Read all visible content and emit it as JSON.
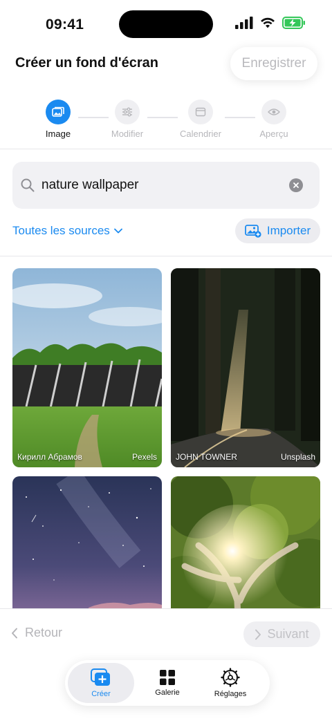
{
  "status_bar": {
    "time": "09:41"
  },
  "header": {
    "title": "Créer un fond d'écran",
    "save_label": "Enregistrer"
  },
  "stepper": {
    "steps": [
      {
        "label": "Image",
        "icon": "image-icon",
        "active": true
      },
      {
        "label": "Modifier",
        "icon": "sliders-icon",
        "active": false
      },
      {
        "label": "Calendrier",
        "icon": "calendar-icon",
        "active": false
      },
      {
        "label": "Aperçu",
        "icon": "eye-icon",
        "active": false
      }
    ]
  },
  "search": {
    "value": "nature wallpaper"
  },
  "sources": {
    "filter_label": "Toutes les sources",
    "import_label": "Importer"
  },
  "results": [
    {
      "author": "Кирилл Абрамов",
      "source": "Pexels",
      "scene": "field-with-fence"
    },
    {
      "author": "JOHN TOWNER",
      "source": "Unsplash",
      "scene": "forest-road"
    },
    {
      "author": "",
      "source": "",
      "scene": "starry-sky"
    },
    {
      "author": "",
      "source": "",
      "scene": "tree-canopy-sunburst"
    }
  ],
  "footer": {
    "back_label": "Retour",
    "next_label": "Suivant"
  },
  "tabbar": {
    "tabs": [
      {
        "label": "Créer",
        "icon": "create-plus-icon",
        "active": true
      },
      {
        "label": "Galerie",
        "icon": "grid-icon",
        "active": false
      },
      {
        "label": "Réglages",
        "icon": "settings-gear-icon",
        "active": false
      }
    ]
  },
  "colors": {
    "accent": "#1a8af0",
    "inactive_text": "#b6b6ba",
    "surface": "#f1f1f4"
  }
}
